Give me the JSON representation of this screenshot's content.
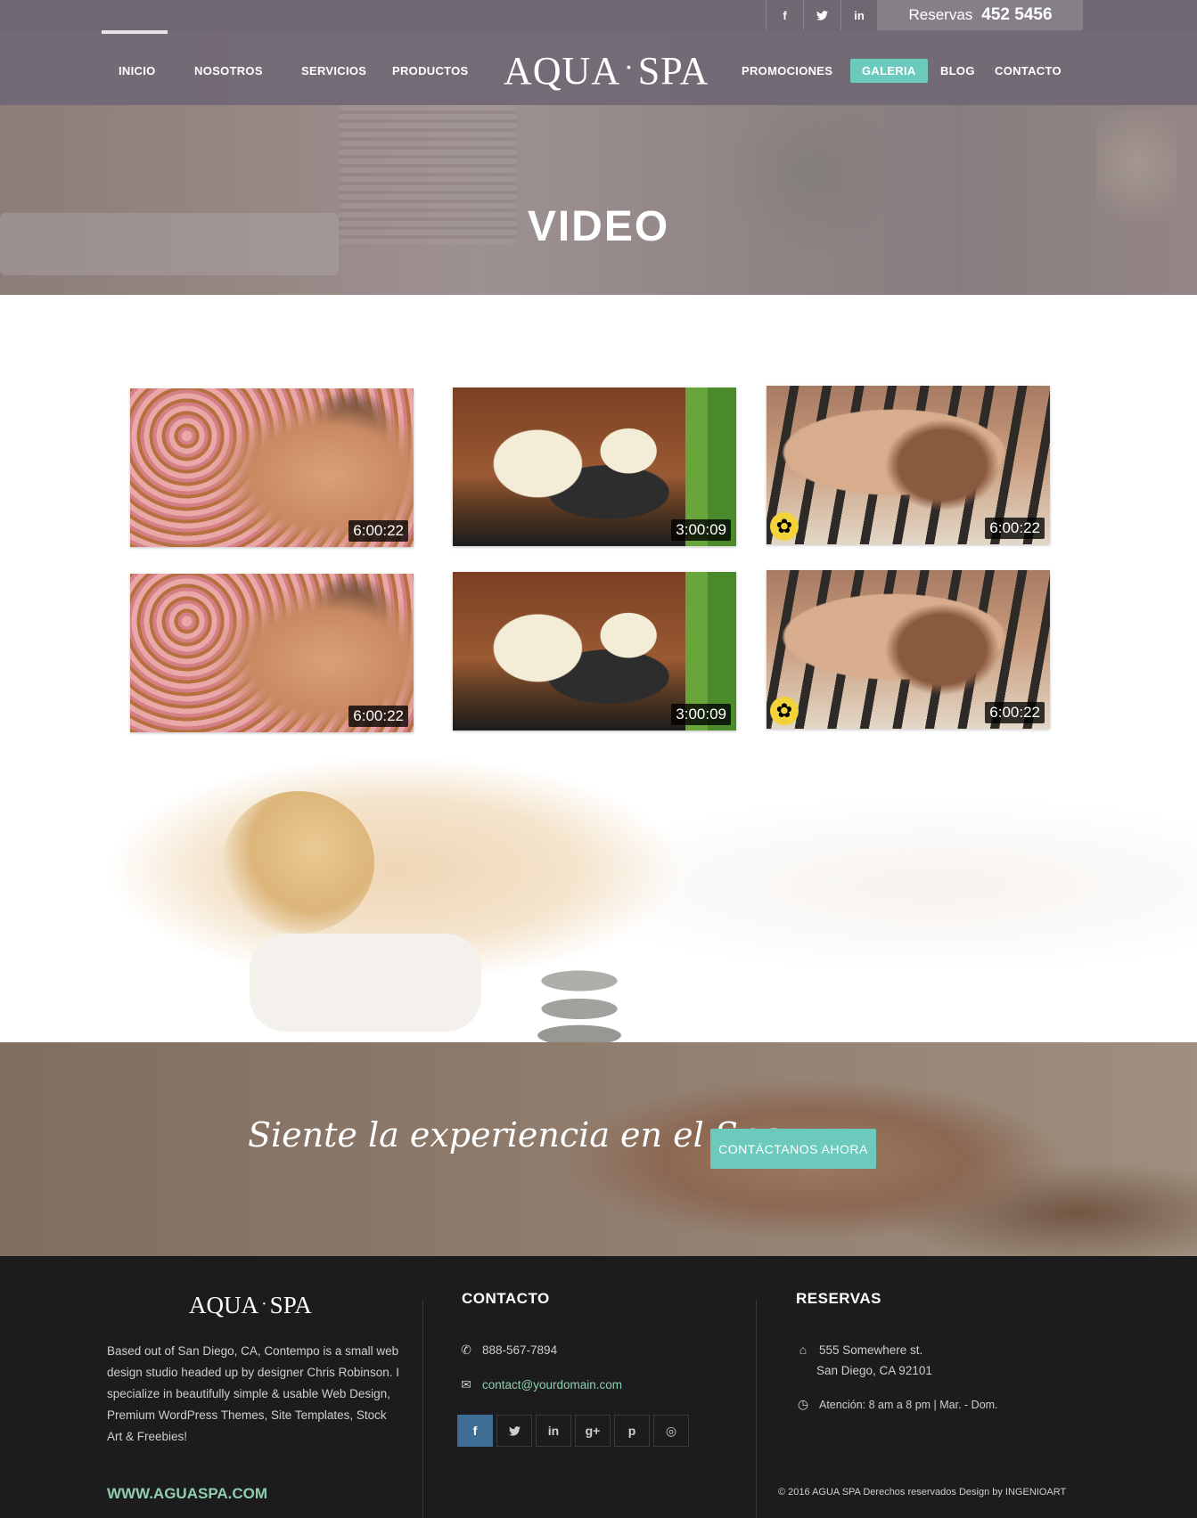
{
  "topbar": {
    "social": [
      {
        "icon": "facebook-icon",
        "label": "f"
      },
      {
        "icon": "twitter-icon",
        "label": "t"
      },
      {
        "icon": "linkedin-icon",
        "label": "in"
      }
    ],
    "reservas_label": "Reservas",
    "reservas_phone": "452 5456"
  },
  "nav": {
    "logo_left": "AQUA",
    "logo_dot": "·",
    "logo_right": "SPA",
    "items": [
      "INICIO",
      "NOSOTROS",
      "SERVICIOS",
      "PRODUCTOS",
      "PROMOCIONES",
      "GALERIA",
      "BLOG",
      "CONTACTO"
    ],
    "active": "GALERIA"
  },
  "hero": {
    "title": "VIDEO"
  },
  "videos": [
    {
      "thumb": "petals",
      "duration": "6:00:22"
    },
    {
      "thumb": "stones",
      "duration": "3:00:09"
    },
    {
      "thumb": "hotstone",
      "duration": "6:00:22"
    },
    {
      "thumb": "petals",
      "duration": "6:00:22"
    },
    {
      "thumb": "stones",
      "duration": "3:00:09"
    },
    {
      "thumb": "hotstone",
      "duration": "6:00:22"
    }
  ],
  "cta": {
    "text": "Siente la experiencia en el Spa",
    "button": "CONTÁCTANOS  AHORA"
  },
  "footer": {
    "logo_left": "AQUA",
    "logo_dot": "·",
    "logo_right": "SPA",
    "about": "Based out of San Diego, CA, Contempo is a small web design studio headed up by designer Chris Robinson. I specialize in beautifully simple & usable Web Design, Premium WordPress Themes, Site Templates, Stock Art & Freebies!",
    "www": "WWW.AGUASPA.COM",
    "contacto": {
      "heading": "CONTACTO",
      "phone": "888-567-7894",
      "email": "contact@yourdomain.com",
      "social": [
        {
          "icon": "facebook-icon",
          "label": "f"
        },
        {
          "icon": "twitter-icon",
          "label": "t"
        },
        {
          "icon": "linkedin-icon",
          "label": "in"
        },
        {
          "icon": "google-plus-icon",
          "label": "g+"
        },
        {
          "icon": "pinterest-icon",
          "label": "p"
        },
        {
          "icon": "instagram-icon",
          "label": "◎"
        }
      ]
    },
    "reservas": {
      "heading": "RESERVAS",
      "address_line1": "555 Somewhere st.",
      "address_line2": "San Diego, CA 92101",
      "hours": "Atención: 8 am a 8 pm  |  Mar. - Dom."
    },
    "copyright": "© 2016   AGUA SPA   Derechos reservados Design by INGENIOART"
  },
  "colors": {
    "accent": "#6bcabb",
    "topbar": "#6f6873",
    "footer_bg": "#1c1b1d",
    "link_green": "#8fcfae",
    "facebook_blue": "#3e6e94"
  }
}
